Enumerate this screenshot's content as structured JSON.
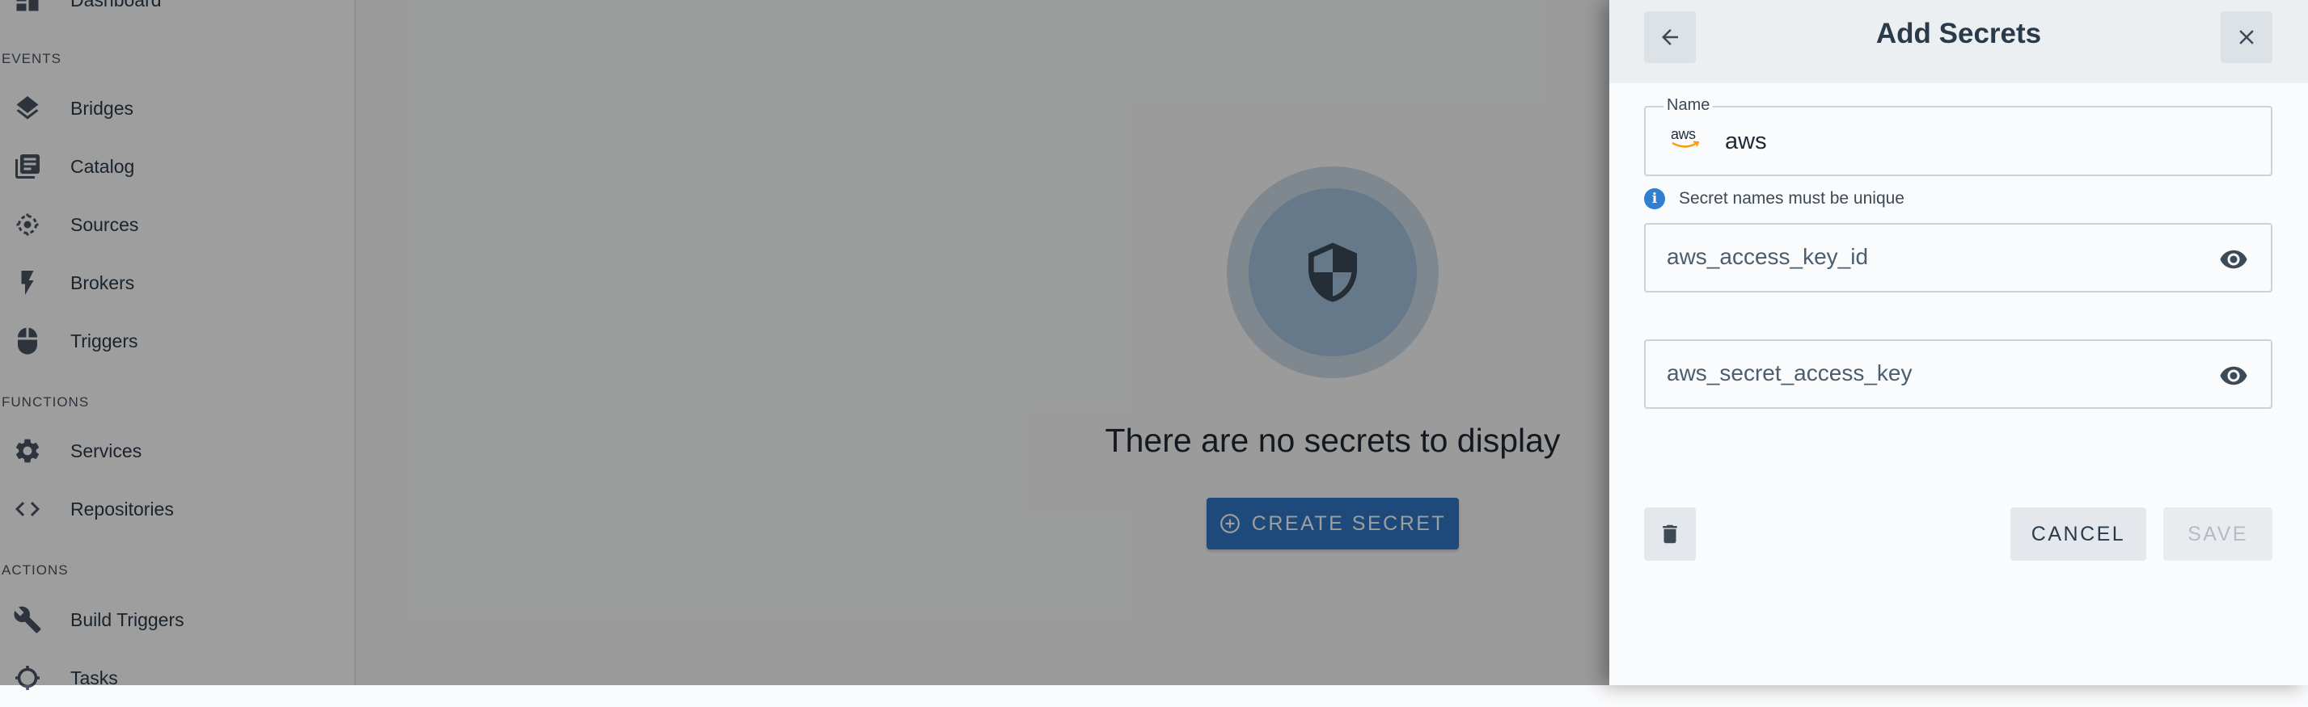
{
  "sidebar": {
    "partial_item": {
      "label": "Dashboard",
      "icon": "dashboard-icon"
    },
    "sections": [
      {
        "title": "EVENTS"
      },
      {
        "title": "FUNCTIONS"
      },
      {
        "title": "ACTIONS"
      }
    ],
    "items": [
      {
        "label": "Bridges",
        "icon": "layers-icon"
      },
      {
        "label": "Catalog",
        "icon": "library-books-icon"
      },
      {
        "label": "Sources",
        "icon": "target-icon"
      },
      {
        "label": "Brokers",
        "icon": "flash-icon"
      },
      {
        "label": "Triggers",
        "icon": "mouse-icon"
      },
      {
        "label": "Services",
        "icon": "gear-icon"
      },
      {
        "label": "Repositories",
        "icon": "code-icon"
      },
      {
        "label": "Build Triggers",
        "icon": "wrench-icon"
      },
      {
        "label": "Tasks",
        "icon": "tasks-icon"
      }
    ]
  },
  "main": {
    "empty_message": "There are no secrets to display",
    "create_button_label": "CREATE SECRET",
    "empty_icon": "shield-icon"
  },
  "drawer": {
    "title": "Add Secrets",
    "back_icon": "arrow-back-icon",
    "close_icon": "close-icon",
    "name_field": {
      "legend": "Name",
      "value": "aws",
      "logo_text": "aws",
      "logo": "aws-logo"
    },
    "helper_text": "Secret names must be unique",
    "secrets": [
      {
        "label": "aws_access_key_id",
        "icon": "eye-icon"
      },
      {
        "label": "aws_secret_access_key",
        "icon": "eye-icon"
      }
    ],
    "delete_icon": "trash-icon",
    "cancel_label": "CANCEL",
    "save_label": "SAVE"
  },
  "colors": {
    "accent": "#2f78c6",
    "info": "#2f80d0",
    "text_dark": "#2b3a4a"
  }
}
